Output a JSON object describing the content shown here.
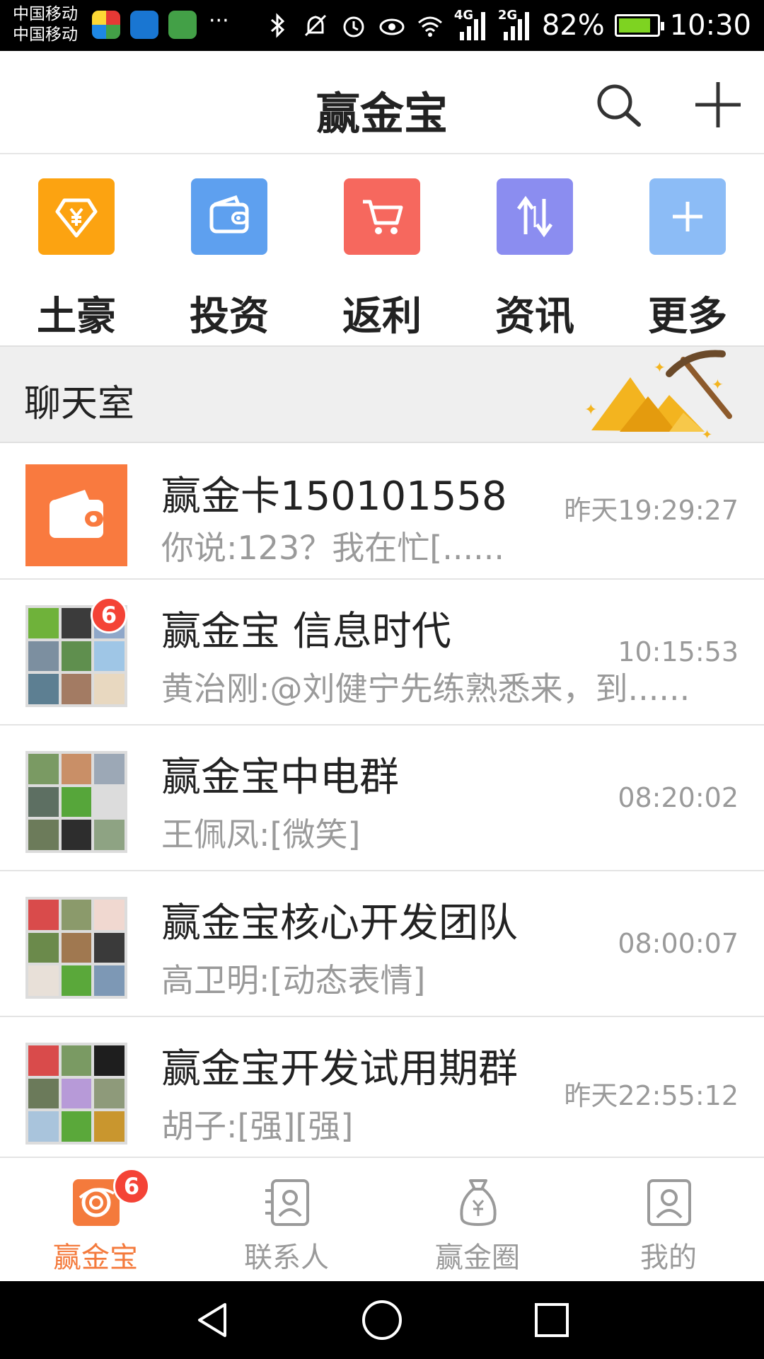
{
  "status_bar": {
    "carrier_1": "中国移动",
    "carrier_2": "中国移动",
    "overflow_dots": "···",
    "net_1": "4G",
    "net_2": "2G",
    "battery_text": "82%",
    "battery_level": 0.82,
    "time": "10:30"
  },
  "header": {
    "title": "赢金宝",
    "search_icon": "search-icon",
    "add_icon": "plus-icon"
  },
  "quick_nav": [
    {
      "label": "土豪",
      "icon": "diamond-yuan-icon",
      "color": "#fca311"
    },
    {
      "label": "投资",
      "icon": "wallet-icon",
      "color": "#5ea0ef"
    },
    {
      "label": "返利",
      "icon": "cart-icon",
      "color": "#f6685e"
    },
    {
      "label": "资讯",
      "icon": "exchange-arrows-icon",
      "color": "#8b8df0"
    },
    {
      "label": "更多",
      "icon": "plus-icon",
      "color": "#8cbcf6"
    }
  ],
  "section": {
    "title": "聊天室",
    "art": "gold-mine-pickaxe-icon"
  },
  "chats": [
    {
      "name": "赢金卡150101558",
      "message": "你说:123？我在忙[......",
      "time": "昨天19:29:27",
      "badge": ""
    },
    {
      "name": "赢金宝 信息时代",
      "message": "黄治刚:@刘健宁先练熟悉来，到......",
      "time": "10:15:53",
      "badge": "6"
    },
    {
      "name": "赢金宝中电群",
      "message": "王佩凤:[微笑]",
      "time": "08:20:02",
      "badge": ""
    },
    {
      "name": "赢金宝核心开发团队",
      "message": "高卫明:[动态表情]",
      "time": "08:00:07",
      "badge": ""
    },
    {
      "name": "赢金宝开发试用期群",
      "message": "胡子:[强][强]",
      "time": "昨天22:55:12",
      "badge": ""
    }
  ],
  "tabs": [
    {
      "label": "赢金宝",
      "icon": "coin-orbit-icon",
      "active": true,
      "badge": "6"
    },
    {
      "label": "联系人",
      "icon": "contacts-icon",
      "active": false,
      "badge": ""
    },
    {
      "label": "赢金圈",
      "icon": "money-bag-icon",
      "active": false,
      "badge": ""
    },
    {
      "label": "我的",
      "icon": "profile-icon",
      "active": false,
      "badge": ""
    }
  ],
  "colors": {
    "accent": "#f47a3c",
    "badge": "#f44336",
    "muted": "#9a9a9a"
  }
}
